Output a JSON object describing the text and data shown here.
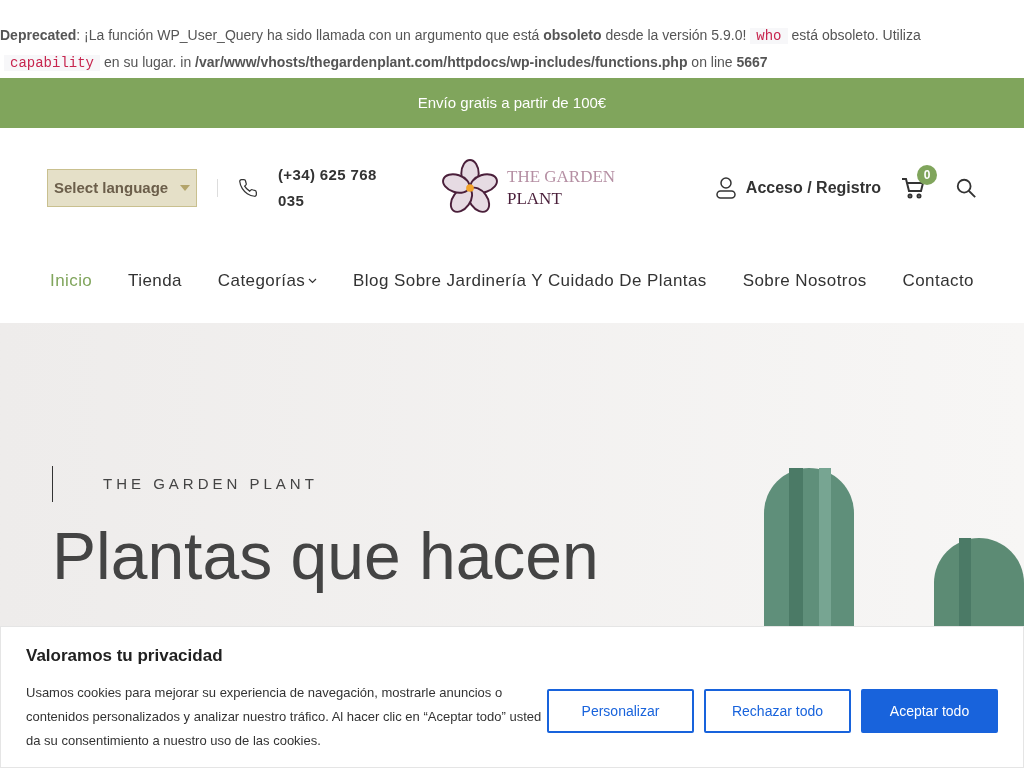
{
  "notice": {
    "lines": [
      [
        {
          "kind": "text",
          "text": "**Deprecated**: ¡La función WP_User_Query ha sido llamada con un argumento que está **obsoleto** desde la versión 5.9.0!"
        },
        {
          "kind": "code",
          "text": "who"
        },
        {
          "kind": "text",
          "text": "está obsoleto. Utiliza"
        }
      ],
      [
        {
          "kind": "code",
          "text": "capability"
        },
        {
          "kind": "text",
          "text": "en su lugar. in **/var/www/vhosts/thegardenplant.com/httpdocs/wp-includes/functions.php** on line **5667**"
        }
      ]
    ]
  },
  "promo_bar": "Envío gratis a partir de 100€",
  "header": {
    "language_select": "Select language",
    "phone": "(+34) 625 768 035",
    "logo": {
      "line1": "THE GARDEN",
      "line2": "PLANT"
    },
    "account": "Acceso / Registro",
    "cart_count": "0"
  },
  "nav": [
    {
      "label": "Inicio",
      "selected": true,
      "dropdown": false
    },
    {
      "label": "Tienda",
      "selected": false,
      "dropdown": false
    },
    {
      "label": "Categorías",
      "selected": false,
      "dropdown": true
    },
    {
      "label": "Blog Sobre Jardinería Y Cuidado De Plantas",
      "selected": false,
      "dropdown": false
    },
    {
      "label": "Sobre Nosotros",
      "selected": false,
      "dropdown": false
    },
    {
      "label": "Contacto",
      "selected": false,
      "dropdown": false
    }
  ],
  "hero": {
    "eyebrow": "THE GARDEN PLANT",
    "heading": "Plantas que hacen"
  },
  "cookie_banner": {
    "title": "Valoramos tu privacidad",
    "text": "Usamos cookies para mejorar su experiencia de navegación, mostrarle anuncios o contenidos personalizados y analizar nuestro tráfico. Al hacer clic en “Aceptar todo” usted da su consentimiento a nuestro uso de las cookies.",
    "buttons": [
      {
        "label": "Personalizar",
        "kind": "outline"
      },
      {
        "label": "Rechazar todo",
        "kind": "outline"
      },
      {
        "label": "Aceptar todo",
        "kind": "primary"
      }
    ]
  }
}
